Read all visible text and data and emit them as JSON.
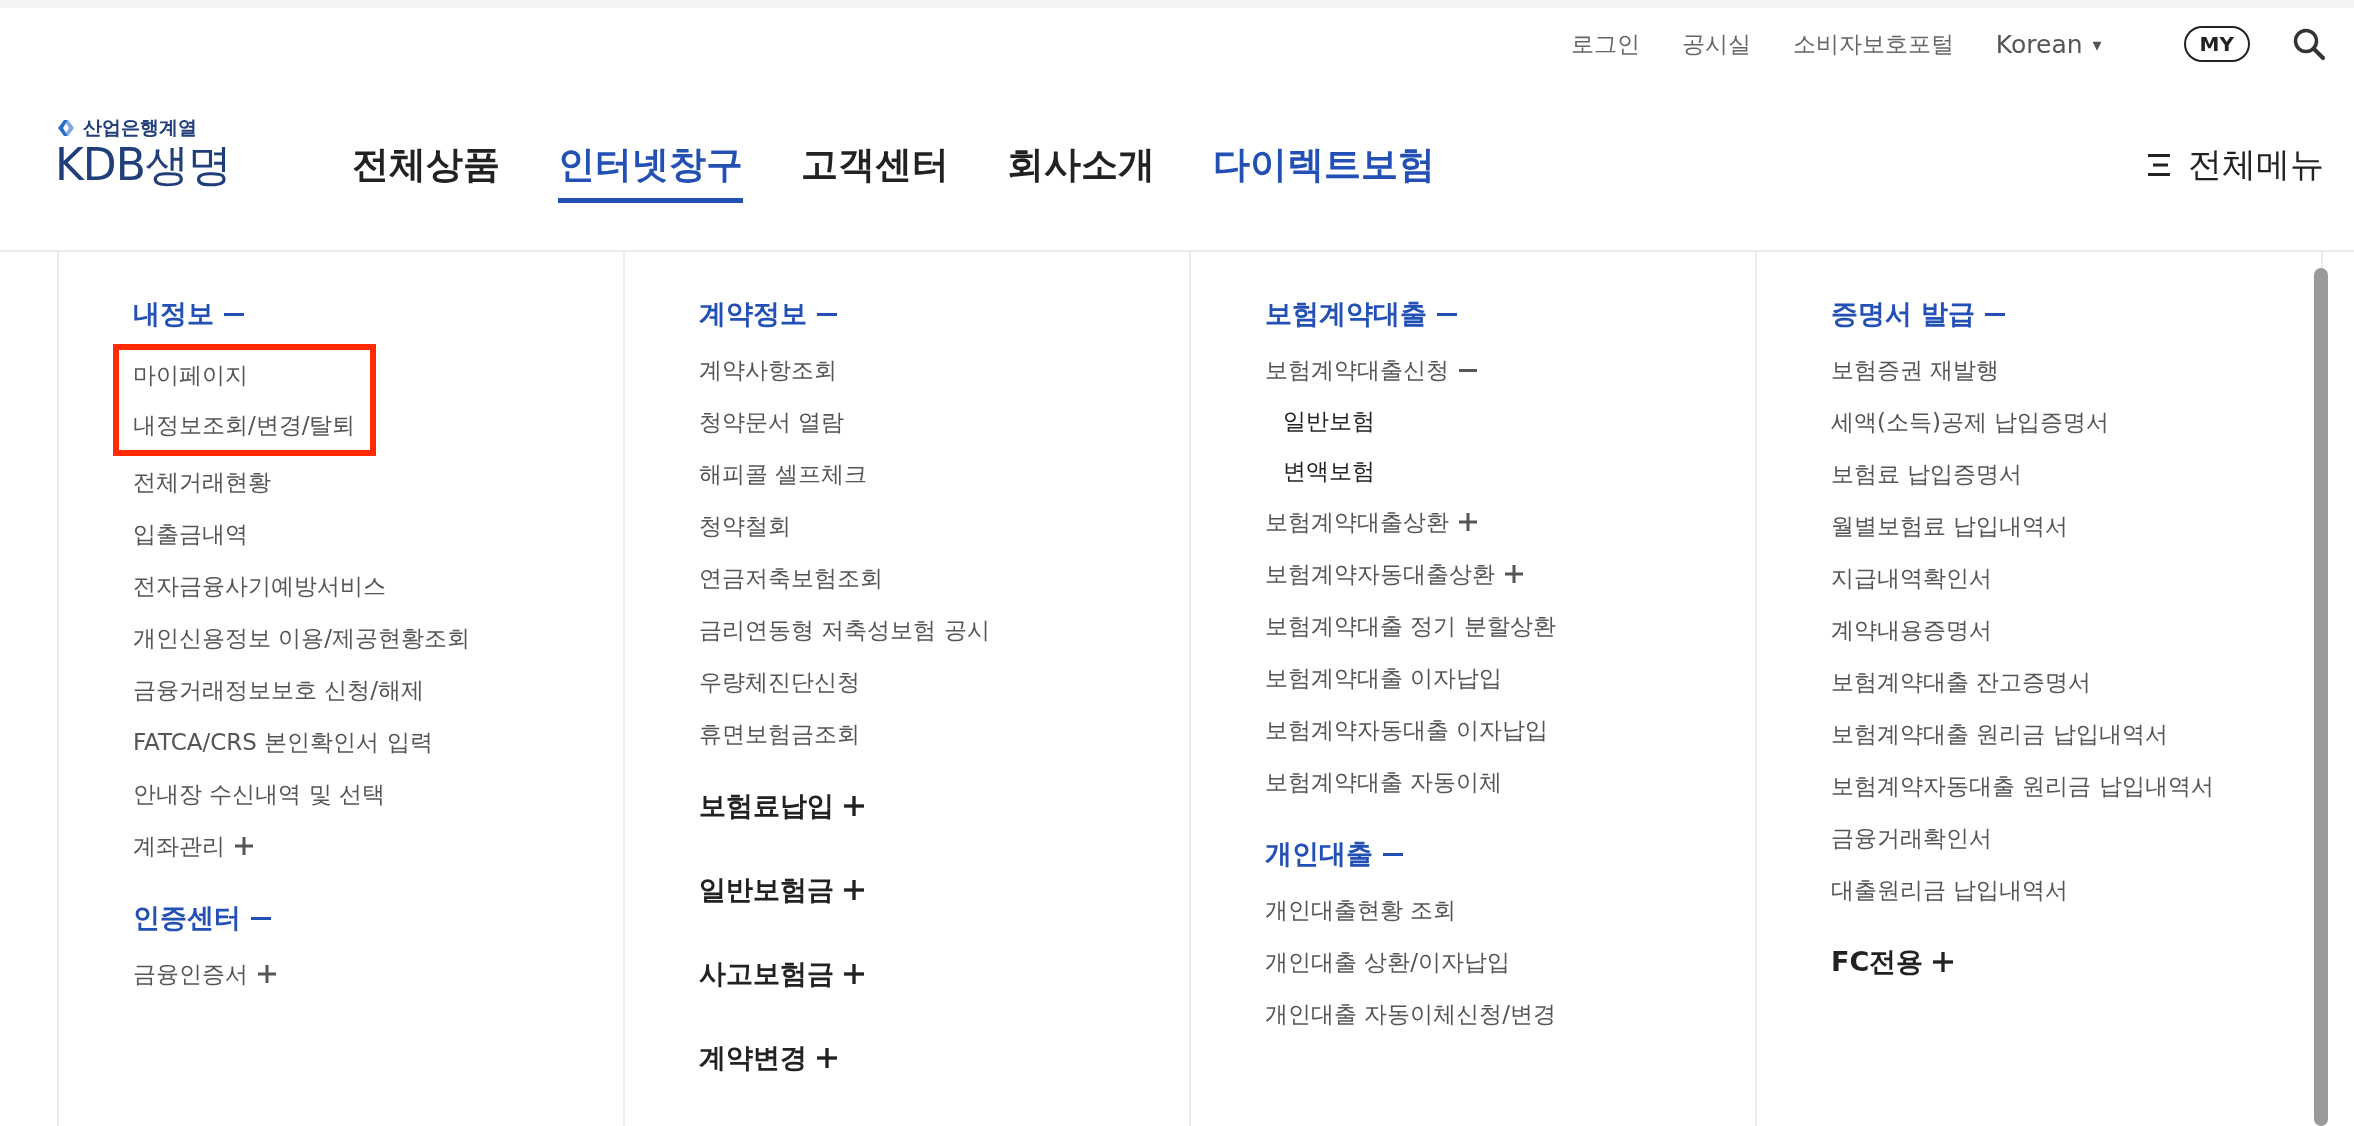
{
  "utility_links": [
    "로그인",
    "공시실",
    "소비자보호포털"
  ],
  "language": {
    "label": "Korean",
    "caret": "▾"
  },
  "my_button": "MY",
  "logo": {
    "tagline": "산업은행계열",
    "name": "KDB생명"
  },
  "nav": [
    {
      "label": "전체상품",
      "selected": false,
      "accent": false
    },
    {
      "label": "인터넷창구",
      "selected": true,
      "accent": true
    },
    {
      "label": "고객센터",
      "selected": false,
      "accent": false
    },
    {
      "label": "회사소개",
      "selected": false,
      "accent": false
    },
    {
      "label": "다이렉트보험",
      "selected": false,
      "accent": true
    }
  ],
  "all_menu": "전체메뉴",
  "columns": [
    {
      "sections": [
        {
          "title": "내정보",
          "expanded": true,
          "items": [
            {
              "label": "마이페이지",
              "highlighted": true
            },
            {
              "label": "내정보조회/변경/탈퇴",
              "highlighted": true
            },
            {
              "label": "전체거래현황",
              "highlighted": false
            },
            {
              "label": "입출금내역",
              "highlighted": false
            },
            {
              "label": "전자금융사기예방서비스",
              "highlighted": false
            },
            {
              "label": "개인신용정보 이용/제공현황조회",
              "highlighted": false
            },
            {
              "label": "금융거래정보보호 신청/해제",
              "highlighted": false
            },
            {
              "label": "FATCA/CRS 본인확인서 입력",
              "highlighted": false
            },
            {
              "label": "안내장 수신내역 및 선택",
              "highlighted": false
            },
            {
              "label": "계좌관리",
              "highlighted": false,
              "expanded": false
            }
          ]
        },
        {
          "title": "인증센터",
          "expanded": true,
          "items": [
            {
              "label": "금융인증서",
              "highlighted": false,
              "expanded": false
            }
          ]
        }
      ]
    },
    {
      "sections": [
        {
          "title": "계약정보",
          "expanded": true,
          "items": [
            {
              "label": "계약사항조회",
              "highlighted": false
            },
            {
              "label": "청약문서 열람",
              "highlighted": false
            },
            {
              "label": "해피콜 셀프체크",
              "highlighted": false
            },
            {
              "label": "청약철회",
              "highlighted": false
            },
            {
              "label": "연금저축보험조회",
              "highlighted": false
            },
            {
              "label": "금리연동형 저축성보험 공시",
              "highlighted": false
            },
            {
              "label": "우량체진단신청",
              "highlighted": false
            },
            {
              "label": "휴면보험금조회",
              "highlighted": false
            }
          ]
        },
        {
          "title": "보험료납입",
          "expanded": false
        },
        {
          "title": "일반보험금",
          "expanded": false
        },
        {
          "title": "사고보험금",
          "expanded": false
        },
        {
          "title": "계약변경",
          "expanded": false
        }
      ]
    },
    {
      "sections": [
        {
          "title": "보험계약대출",
          "expanded": true,
          "items": [
            {
              "label": "보험계약대출신청",
              "highlighted": false,
              "expanded": true,
              "children": [
                {
                  "label": "일반보험"
                },
                {
                  "label": "변액보험"
                }
              ]
            },
            {
              "label": "보험계약대출상환",
              "highlighted": false,
              "expanded": false
            },
            {
              "label": "보험계약자동대출상환",
              "highlighted": false,
              "expanded": false
            },
            {
              "label": "보험계약대출 정기 분할상환",
              "highlighted": false
            },
            {
              "label": "보험계약대출 이자납입",
              "highlighted": false
            },
            {
              "label": "보험계약자동대출 이자납입",
              "highlighted": false
            },
            {
              "label": "보험계약대출 자동이체",
              "highlighted": false
            }
          ]
        },
        {
          "title": "개인대출",
          "expanded": true,
          "items": [
            {
              "label": "개인대출현황 조회",
              "highlighted": false
            },
            {
              "label": "개인대출 상환/이자납입",
              "highlighted": false
            },
            {
              "label": "개인대출 자동이체신청/변경",
              "highlighted": false
            }
          ]
        }
      ]
    },
    {
      "sections": [
        {
          "title": "증명서 발급",
          "expanded": true,
          "items": [
            {
              "label": "보험증권 재발행",
              "highlighted": false
            },
            {
              "label": "세액(소득)공제 납입증명서",
              "highlighted": false
            },
            {
              "label": "보험료 납입증명서",
              "highlighted": false
            },
            {
              "label": "월별보험료 납입내역서",
              "highlighted": false
            },
            {
              "label": "지급내역확인서",
              "highlighted": false
            },
            {
              "label": "계약내용증명서",
              "highlighted": false
            },
            {
              "label": "보험계약대출 잔고증명서",
              "highlighted": false
            },
            {
              "label": "보험계약대출 원리금 납입내역서",
              "highlighted": false
            },
            {
              "label": "보험계약자동대출 원리금 납입내역서",
              "highlighted": false
            },
            {
              "label": "금융거래확인서",
              "highlighted": false
            },
            {
              "label": "대출원리금 납입내역서",
              "highlighted": false
            }
          ]
        },
        {
          "title": "FC전용",
          "expanded": false
        }
      ]
    }
  ]
}
